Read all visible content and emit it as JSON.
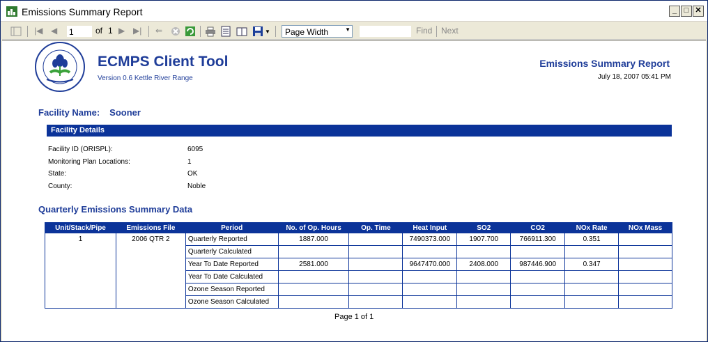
{
  "window": {
    "title": "Emissions Summary Report"
  },
  "toolbar": {
    "page_value": "1",
    "of_label": "of",
    "total_pages": "1",
    "zoom_value": "Page Width",
    "find_label": "Find",
    "next_label": "Next"
  },
  "header": {
    "app_title": "ECMPS Client Tool",
    "version": "Version 0.6 Kettle River Range",
    "report_title": "Emissions Summary Report",
    "report_date": "July 18, 2007 05:41 PM"
  },
  "facility": {
    "name_label": "Facility Name:",
    "name_value": "Sooner",
    "details_title": "Facility Details",
    "details": [
      {
        "label": "Facility ID (ORISPL):",
        "value": "6095"
      },
      {
        "label": "Monitoring Plan Locations:",
        "value": "1"
      },
      {
        "label": "State:",
        "value": "OK"
      },
      {
        "label": "County:",
        "value": "Noble"
      }
    ]
  },
  "summary": {
    "title": "Quarterly Emissions Summary Data",
    "columns": [
      "Unit/Stack/Pipe",
      "Emissions File",
      "Period",
      "No. of Op. Hours",
      "Op. Time",
      "Heat Input",
      "SO2",
      "CO2",
      "NOx Rate",
      "NOx Mass"
    ],
    "unit": "1",
    "file": "2006 QTR 2",
    "rows": [
      {
        "period": "Quarterly Reported",
        "hours": "1887.000",
        "optime": "",
        "heat": "7490373.000",
        "so2": "1907.700",
        "co2": "766911.300",
        "noxrate": "0.351",
        "noxmass": ""
      },
      {
        "period": "Quarterly Calculated",
        "hours": "",
        "optime": "",
        "heat": "",
        "so2": "",
        "co2": "",
        "noxrate": "",
        "noxmass": ""
      },
      {
        "period": "Year To Date Reported",
        "hours": "2581.000",
        "optime": "",
        "heat": "9647470.000",
        "so2": "2408.000",
        "co2": "987446.900",
        "noxrate": "0.347",
        "noxmass": ""
      },
      {
        "period": "Year To Date Calculated",
        "hours": "",
        "optime": "",
        "heat": "",
        "so2": "",
        "co2": "",
        "noxrate": "",
        "noxmass": ""
      },
      {
        "period": "Ozone Season Reported",
        "hours": "",
        "optime": "",
        "heat": "",
        "so2": "",
        "co2": "",
        "noxrate": "",
        "noxmass": ""
      },
      {
        "period": "Ozone Season Calculated",
        "hours": "",
        "optime": "",
        "heat": "",
        "so2": "",
        "co2": "",
        "noxrate": "",
        "noxmass": ""
      }
    ]
  },
  "footer": {
    "page_of": "Page 1 of 1"
  }
}
